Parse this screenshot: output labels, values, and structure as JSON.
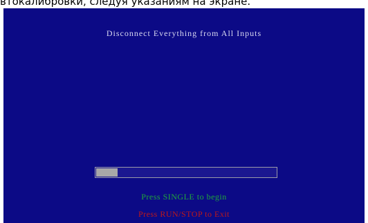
{
  "caption": "втокалибровки, следуя указаниям на экране.",
  "screen": {
    "title": "Disconnect Everything from All Inputs",
    "progress": {
      "fraction": 0.12,
      "fill_color": "#a8a8a8"
    },
    "prompt_begin": "Press SINGLE to begin",
    "prompt_exit": "Press RUN/STOP to Exit",
    "colors": {
      "background": "#0c0a86",
      "prompt_begin": "#1fa83a",
      "prompt_exit": "#c01818"
    }
  }
}
